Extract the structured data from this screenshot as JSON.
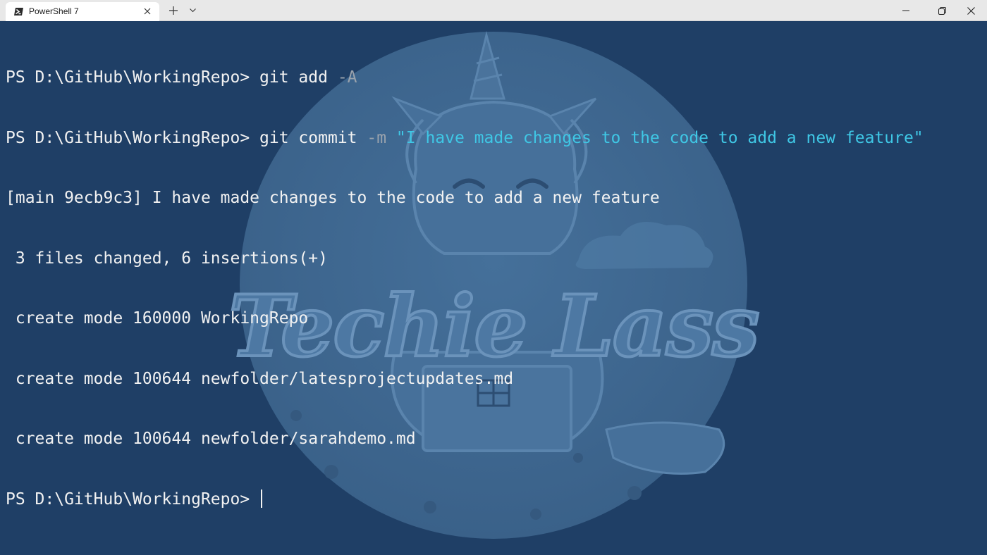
{
  "window": {
    "tab_title": "PowerShell 7",
    "tab_icon": "powershell-icon",
    "new_tab_icon": "plus-icon",
    "dropdown_icon": "chevron-down-icon",
    "controls": [
      "minimize-icon",
      "maximize-icon",
      "close-icon"
    ]
  },
  "terminal": {
    "prompt": "PS D:\\GitHub\\WorkingRepo> ",
    "lines": [
      {
        "prompt": "PS D:\\GitHub\\WorkingRepo> ",
        "command": "git",
        "args": " add",
        "flag": " -A"
      },
      {
        "prompt": "PS D:\\GitHub\\WorkingRepo> ",
        "command": "git",
        "args": " commit",
        "flag": " -m",
        "string": " \"I have made changes to the code to add a new feature\""
      }
    ],
    "output": [
      "[main 9ecb9c3] I have made changes to the code to add a new feature",
      " 3 files changed, 6 insertions(+)",
      " create mode 160000 WorkingRepo",
      " create mode 100644 newfolder/latesprojectupdates.md",
      " create mode 100644 newfolder/sarahdemo.md"
    ],
    "final_prompt": "PS D:\\GitHub\\WorkingRepo> "
  },
  "background": {
    "watermark_text": "Techie Lass",
    "colors": {
      "terminal_bg": "#1f3f66",
      "circle": "#3f6790",
      "text": "#f2f2f2",
      "string": "#3fc7e5",
      "flag": "#9aa3ad"
    }
  }
}
